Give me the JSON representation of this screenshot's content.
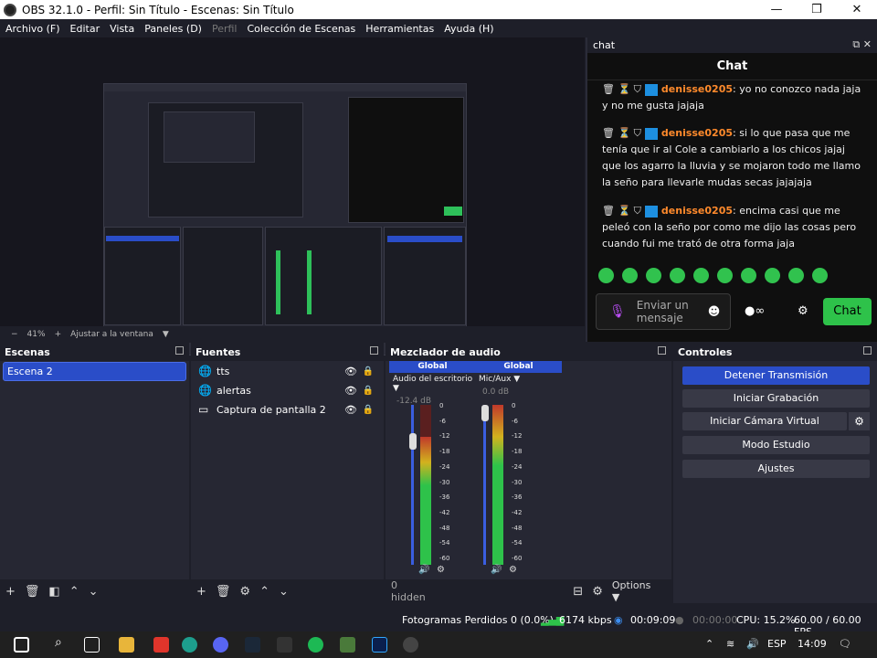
{
  "titlebar": {
    "title": "OBS 32.1.0 - Perfil: Sin Título - Escenas: Sin Título",
    "minimize": "—",
    "restore": "❒",
    "close": "✕"
  },
  "menu": [
    "Archivo (F)",
    "Editar",
    "Vista",
    "Paneles (D)",
    "Perfil",
    "Colección de Escenas",
    "Herramientas",
    "Ayuda (H)"
  ],
  "preview": {
    "zoom": "41%",
    "fit_label": "Ajustar a la ventana",
    "minus": "−",
    "plus": "+"
  },
  "chat": {
    "dock_title": "chat",
    "header": "Chat",
    "messages": [
      {
        "user": "denisse0205",
        "text": ": yo no conozco nada jaja y no me gusta jajaja"
      },
      {
        "user": "denisse0205",
        "text": ": si lo que pasa que me tenía que ir al Cole a cambiarlo a los chicos jajaj que los agarro la lluvia y se mojaron todo me llamo la seño para llevarle mudas secas jajajaja"
      },
      {
        "user": "denisse0205",
        "text": ": encima casi que me peleó con la seño por como me dijo las cosas pero cuando fui me trató de otra forma jaja"
      }
    ],
    "input_placeholder": "Enviar un mensaje",
    "send_label": "Chat",
    "emote_count": 10
  },
  "scenes": {
    "title": "Escenas",
    "items": [
      "Escena 2"
    ]
  },
  "sources": {
    "title": "Fuentes",
    "items": [
      {
        "name": "tts",
        "icon": "globe-icon"
      },
      {
        "name": "alertas",
        "icon": "globe-icon"
      },
      {
        "name": "Captura de pantalla 2",
        "icon": "monitor-icon"
      }
    ]
  },
  "mixer": {
    "title": "Mezclador de audio",
    "channels": [
      {
        "scope": "Global",
        "name": "Audio del escritorio",
        "db": "-12.4 dB",
        "level": 0.8
      },
      {
        "scope": "Global",
        "name": "Mic/Aux",
        "db": "0.0 dB",
        "level": 1.0
      }
    ],
    "scale": [
      "0",
      "-6",
      "-12",
      "-18",
      "-24",
      "-30",
      "-36",
      "-42",
      "-48",
      "-54",
      "-60"
    ],
    "hidden_label": "0 hidden",
    "options_label": "Options"
  },
  "controls": {
    "title": "Controles",
    "buttons": [
      "Detener Transmisión",
      "Iniciar Grabación",
      "Iniciar Cámara Virtual",
      "Modo Estudio",
      "Ajustes"
    ]
  },
  "status": {
    "dropped": "Fotogramas Perdidos 0 (0.0%)",
    "bitrate": "6174 kbps",
    "stream_time": "00:09:09",
    "rec_time": "00:00:00",
    "cpu": "CPU: 15.2%",
    "fps": "60.00 / 60.00 FPS"
  },
  "taskbar": {
    "lang": "ESP",
    "time": "14:09"
  },
  "colors": {
    "accent": "#2a4dc8",
    "chat_username": "#ff8a2c",
    "chat_send": "#2ec24a"
  }
}
